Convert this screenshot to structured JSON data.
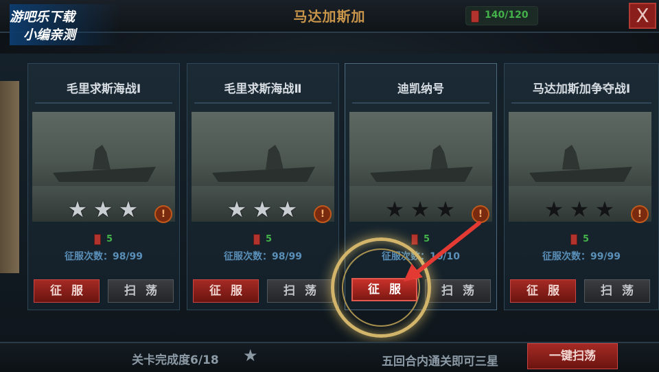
{
  "header": {
    "title": "马达加斯加",
    "fuel": "140/120",
    "close_label": "X"
  },
  "watermark": {
    "line1": "游吧乐下载",
    "line2": "小编亲测"
  },
  "cards": [
    {
      "name": "毛里求斯海战Ⅰ",
      "stars_earned": 3,
      "fuel_cost": "5",
      "count_label": "征服次数：98/99",
      "conquer_label": "征服",
      "sweep_label": "扫荡",
      "alert": "!"
    },
    {
      "name": "毛里求斯海战Ⅱ",
      "stars_earned": 3,
      "fuel_cost": "5",
      "count_label": "征服次数：98/99",
      "conquer_label": "征服",
      "sweep_label": "扫荡",
      "alert": "!"
    },
    {
      "name": "迪凯纳号",
      "stars_earned": 0,
      "fuel_cost": "5",
      "count_label": "征服次数：10/10",
      "conquer_label": "征服",
      "sweep_label": "扫荡",
      "alert": "!"
    },
    {
      "name": "马达加斯加争夺战Ⅰ",
      "stars_earned": 0,
      "fuel_cost": "5",
      "count_label": "征服次数：99/99",
      "conquer_label": "征服",
      "sweep_label": "扫荡",
      "alert": "!"
    }
  ],
  "footer": {
    "progress": "关卡完成度6/18",
    "hint": "五回合内通关即可三星",
    "sweep_all_label": "一键扫荡"
  },
  "colors": {
    "accent_red": "#a52a24",
    "fuel_green": "#44b24b",
    "title_gold": "#c8954a",
    "focus_gold": "#d2b46a",
    "arrow_red": "#e33b34"
  }
}
